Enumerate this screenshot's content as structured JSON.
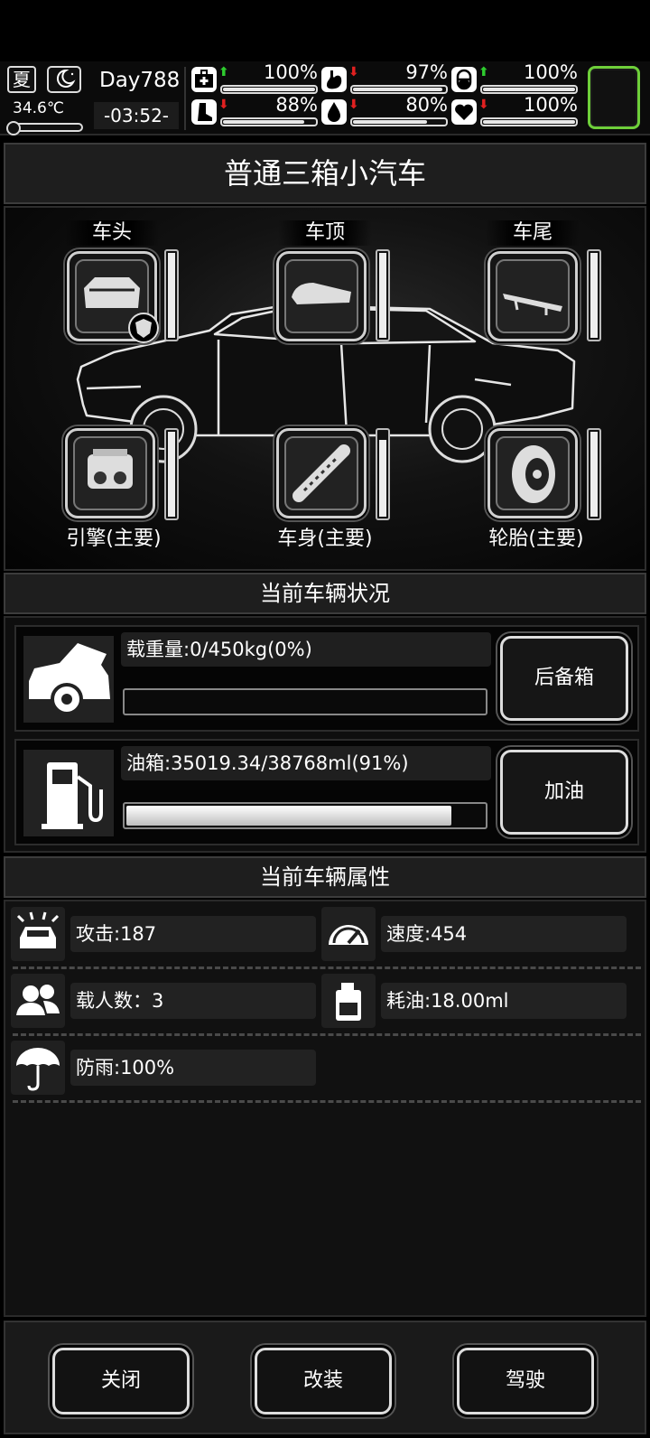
{
  "status_bar": {
    "season": "夏",
    "temperature": "34.6℃",
    "day": "Day788",
    "clock": "-03:52-",
    "stats": [
      {
        "icon": "medkit-icon",
        "trend": "up",
        "value": "100%",
        "level": 1.0
      },
      {
        "icon": "stomach-icon",
        "trend": "down",
        "value": "97%",
        "level": 0.97
      },
      {
        "icon": "capsule-icon",
        "trend": "up",
        "value": "100%",
        "level": 1.0
      },
      {
        "icon": "boot-icon",
        "trend": "down",
        "value": "88%",
        "level": 0.88
      },
      {
        "icon": "water-drop-icon",
        "trend": "down",
        "value": "80%",
        "level": 0.8
      },
      {
        "icon": "heart-icon",
        "trend": "down",
        "value": "100%",
        "level": 1.0
      }
    ]
  },
  "vehicle": {
    "name": "普通三箱小汽车",
    "parts": [
      {
        "label": "车头",
        "icon": "car-hood-icon",
        "durability": 1.0
      },
      {
        "label": "车顶",
        "icon": "roof-box-icon",
        "durability": 1.0
      },
      {
        "label": "车尾",
        "icon": "spoiler-icon",
        "durability": 1.0
      },
      {
        "label": "引擎(主要)",
        "icon": "engine-icon",
        "durability": 1.0
      },
      {
        "label": "车身(主要)",
        "icon": "chassis-icon",
        "durability": 0.9
      },
      {
        "label": "轮胎(主要)",
        "icon": "tire-icon",
        "durability": 1.0
      }
    ]
  },
  "status_section": {
    "title": "当前车辆状况",
    "load": {
      "text": "载重量:0/450kg(0%)",
      "level": 0.0,
      "button": "后备箱"
    },
    "fuel": {
      "text": "油箱:35019.34/38768ml(91%)",
      "level": 0.91,
      "button": "加油"
    }
  },
  "attr_section": {
    "title": "当前车辆属性",
    "attack": "攻击:187",
    "speed": "速度:454",
    "passengers": "载人数：3",
    "fuel_use": "耗油:18.00ml",
    "rainproof": "防雨:100%"
  },
  "footer": {
    "close": "关闭",
    "modify": "改装",
    "drive": "驾驶"
  },
  "colors": {
    "accent_slot": "#6ecf3a",
    "trend_up": "#2ecc2e",
    "trend_down": "#e02020"
  }
}
